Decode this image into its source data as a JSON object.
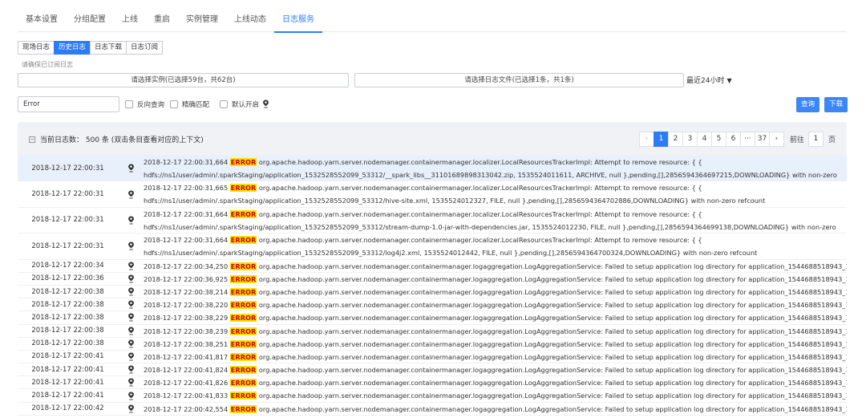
{
  "top_tabs": [
    {
      "label": "基本设置",
      "active": false
    },
    {
      "label": "分组配置",
      "active": false
    },
    {
      "label": "上线",
      "active": false
    },
    {
      "label": "重启",
      "active": false
    },
    {
      "label": "实例管理",
      "active": false
    },
    {
      "label": "上线动态",
      "active": false
    },
    {
      "label": "日志服务",
      "active": true
    }
  ],
  "sub_tabs": [
    {
      "label": "现场日志",
      "active": false
    },
    {
      "label": "历史日志",
      "active": true
    },
    {
      "label": "日志下载",
      "active": false
    },
    {
      "label": "日志订阅",
      "active": false
    }
  ],
  "hint": "请确保已订阅日志",
  "instance_select": "请选择实例(已选择59台，共62台)",
  "file_select": "请选择日志文件(已选择1条，共1条)",
  "time_range": "最近24小时",
  "search": {
    "value": "Error"
  },
  "checks": {
    "reverse": "反向查询",
    "exact": "精确匹配",
    "default_on": "默认开启"
  },
  "buttons": {
    "query": "查询",
    "download": "下载"
  },
  "panel": {
    "title": "当前日志数： 500 条 (双击条目查看对应的上下文)"
  },
  "pager": {
    "pages": [
      "1",
      "2",
      "3",
      "4",
      "5",
      "6",
      "···",
      "37"
    ],
    "active": "1",
    "goto_label": "前往",
    "goto_value": "1",
    "unit": "页"
  },
  "level_word": "ERROR",
  "rows": [
    {
      "time": "2018-12-17 22:00:31",
      "pre": "2018-12-17 22:00:31,664 ",
      "post": " org.apache.hadoop.yarn.server.nodemanager.containermanager.localizer.LocalResourcesTrackerImpl: Attempt to remove resource: { { hdfs://ns1/user/admin/.sparkStaging/application_1532528552099_53312/__spark_libs__3110168989831304​2.zip, 1535524011611, ARCHIVE, null },pending,[],2856594364697215,DOWNLOADING} with non-zero refcount",
      "tall": true,
      "highlight": true
    },
    {
      "time": "2018-12-17 22:00:31",
      "pre": "2018-12-17 22:00:31,665 ",
      "post": " org.apache.hadoop.yarn.server.nodemanager.containermanager.localizer.LocalResourcesTrackerImpl: Attempt to remove resource: { { hdfs://ns1/user/admin/.sparkStaging/application_1532528552099_53312/hive-site.xml, 1535524012327, FILE, null },pending,[],2856594364702886,DOWNLOADING} with non-zero refcount",
      "tall": true,
      "highlight": false
    },
    {
      "time": "2018-12-17 22:00:31",
      "pre": "2018-12-17 22:00:31,664 ",
      "post": " org.apache.hadoop.yarn.server.nodemanager.containermanager.localizer.LocalResourcesTrackerImpl: Attempt to remove resource: { { hdfs://ns1/user/admin/.sparkStaging/application_1532528552099_53312/stream-dump-1.0-jar-with-dependencies.jar, 1535524012230, FILE, null },pending,[],2856594364699138,DOWNLOADING} with non-zero refcount",
      "tall": true,
      "highlight": false
    },
    {
      "time": "2018-12-17 22:00:31",
      "pre": "2018-12-17 22:00:31,664 ",
      "post": " org.apache.hadoop.yarn.server.nodemanager.containermanager.localizer.LocalResourcesTrackerImpl: Attempt to remove resource: { { hdfs://ns1/user/admin/.sparkStaging/application_1532528552099_53312/log4j2.xml, 1535524012442, FILE, null },pending,[],2856594364700324,DOWNLOADING} with non-zero refcount",
      "tall": true,
      "highlight": false
    },
    {
      "time": "2018-12-17 22:00:34",
      "pre": "2018-12-17 22:00:34,250 ",
      "post": " org.apache.hadoop.yarn.server.nodemanager.containermanager.logaggregation.LogAggregationService: Failed to setup application log directory for application_1544688518943_12569",
      "tall": false,
      "highlight": false
    },
    {
      "time": "2018-12-17 22:00:36",
      "pre": "2018-12-17 22:00:36,925 ",
      "post": " org.apache.hadoop.yarn.server.nodemanager.containermanager.logaggregation.LogAggregationService: Failed to setup application log directory for application_1544688518943_12570",
      "tall": false,
      "highlight": false
    },
    {
      "time": "2018-12-17 22:00:38",
      "pre": "2018-12-17 22:00:38,214 ",
      "post": " org.apache.hadoop.yarn.server.nodemanager.containermanager.logaggregation.LogAggregationService: Failed to setup application log directory for application_1544688518943_12568",
      "tall": false,
      "highlight": false
    },
    {
      "time": "2018-12-17 22:00:38",
      "pre": "2018-12-17 22:00:38,220 ",
      "post": " org.apache.hadoop.yarn.server.nodemanager.containermanager.logaggregation.LogAggregationService: Failed to setup application log directory for application_1544688518943_12568",
      "tall": false,
      "highlight": false
    },
    {
      "time": "2018-12-17 22:00:38",
      "pre": "2018-12-17 22:00:38,229 ",
      "post": " org.apache.hadoop.yarn.server.nodemanager.containermanager.logaggregation.LogAggregationService: Failed to setup application log directory for application_1544688518943_12568",
      "tall": false,
      "highlight": false
    },
    {
      "time": "2018-12-17 22:00:38",
      "pre": "2018-12-17 22:00:38,239 ",
      "post": " org.apache.hadoop.yarn.server.nodemanager.containermanager.logaggregation.LogAggregationService: Failed to setup application log directory for application_1544688518943_12568",
      "tall": false,
      "highlight": false
    },
    {
      "time": "2018-12-17 22:00:38",
      "pre": "2018-12-17 22:00:38,251 ",
      "post": " org.apache.hadoop.yarn.server.nodemanager.containermanager.logaggregation.LogAggregationService: Failed to setup application log directory for application_1544688518943_12571",
      "tall": false,
      "highlight": false
    },
    {
      "time": "2018-12-17 22:00:41",
      "pre": "2018-12-17 22:00:41,817 ",
      "post": " org.apache.hadoop.yarn.server.nodemanager.containermanager.logaggregation.LogAggregationService: Failed to setup application log directory for application_1544688518943_12569",
      "tall": false,
      "highlight": false
    },
    {
      "time": "2018-12-17 22:00:41",
      "pre": "2018-12-17 22:00:41,824 ",
      "post": " org.apache.hadoop.yarn.server.nodemanager.containermanager.logaggregation.LogAggregationService: Failed to setup application log directory for application_1544688518943_12569",
      "tall": false,
      "highlight": false
    },
    {
      "time": "2018-12-17 22:00:41",
      "pre": "2018-12-17 22:00:41,826 ",
      "post": " org.apache.hadoop.yarn.server.nodemanager.containermanager.logaggregation.LogAggregationService: Failed to setup application log directory for application_1544688518943_12569",
      "tall": false,
      "highlight": false
    },
    {
      "time": "2018-12-17 22:00:41",
      "pre": "2018-12-17 22:00:41,833 ",
      "post": " org.apache.hadoop.yarn.server.nodemanager.containermanager.logaggregation.LogAggregationService: Failed to setup application log directory for application_1544688518943_12569",
      "tall": false,
      "highlight": false
    },
    {
      "time": "2018-12-17 22:00:42",
      "pre": "2018-12-17 22:00:42,554 ",
      "post": " org.apache.hadoop.yarn.server.nodemanager.containermanager.logaggregation.LogAggregationService: Failed to setup application log directory for application_1544688518943_12570",
      "tall": false,
      "highlight": false
    }
  ]
}
